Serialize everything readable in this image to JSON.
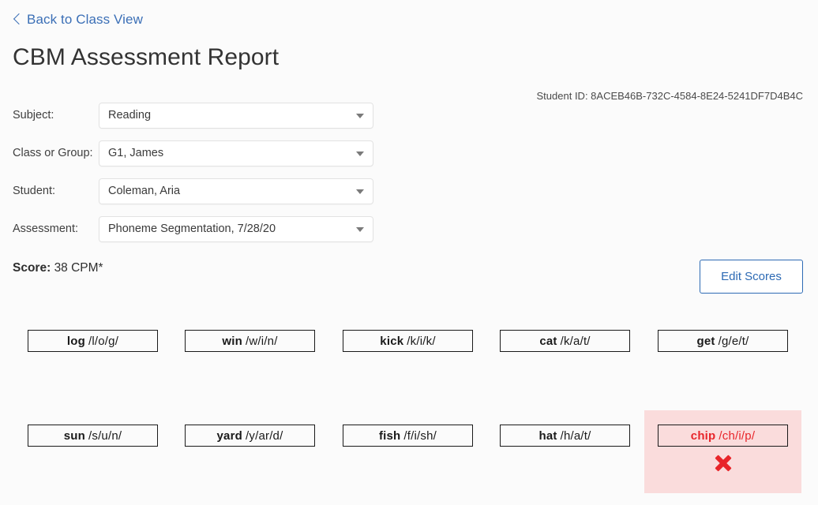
{
  "nav": {
    "back_label": "Back to Class View",
    "back_icon": "chevron-left-icon"
  },
  "header": {
    "title": "CBM Assessment Report",
    "student_id_text": "Student ID: 8ACEB46B-732C-4584-8E24-5241DF7D4B4C"
  },
  "colors": {
    "page_background": "#fbfbfb",
    "link_blue": "#3b6fb6",
    "button_blue": "#2d6ab4",
    "error_red": "#e8252a",
    "error_background": "#fadcdc",
    "text_dark": "#1a1a1a",
    "border_grey": "#e2e2e2"
  },
  "form": {
    "caret_icon": "chevron-down-icon",
    "fields": [
      {
        "label": "Subject:",
        "value": "Reading"
      },
      {
        "label": "Class or Group:",
        "value": "G1, James"
      },
      {
        "label": "Student:",
        "value": "Coleman, Aria"
      },
      {
        "label": "Assessment:",
        "value": "Phoneme Segmentation, 7/28/20"
      }
    ]
  },
  "score": {
    "label": "Score:",
    "value": "38 CPM*"
  },
  "toolbar": {
    "edit_scores_label": "Edit Scores"
  },
  "assessment": {
    "x_icon": "x-mark-icon",
    "rows": [
      [
        {
          "word": "log",
          "phonemes": "/l/o/g/",
          "flagged": false
        },
        {
          "word": "win",
          "phonemes": "/w/i/n/",
          "flagged": false
        },
        {
          "word": "kick",
          "phonemes": "/k/i/k/",
          "flagged": false
        },
        {
          "word": "cat",
          "phonemes": "/k/a/t/",
          "flagged": false
        },
        {
          "word": "get",
          "phonemes": "/g/e/t/",
          "flagged": false
        }
      ],
      [
        {
          "word": "sun",
          "phonemes": "/s/u/n/",
          "flagged": false
        },
        {
          "word": "yard",
          "phonemes": "/y/ar/d/",
          "flagged": false
        },
        {
          "word": "fish",
          "phonemes": "/f/i/sh/",
          "flagged": false
        },
        {
          "word": "hat",
          "phonemes": "/h/a/t/",
          "flagged": false
        },
        {
          "word": "chip",
          "phonemes": "/ch/i/p/",
          "flagged": true
        }
      ]
    ]
  }
}
